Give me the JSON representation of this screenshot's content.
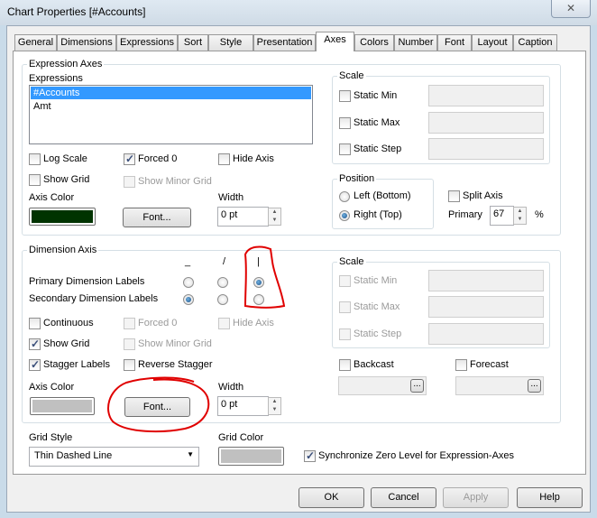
{
  "window": {
    "title": "Chart Properties [#Accounts]",
    "close_icon": "✕"
  },
  "tabs": [
    "General",
    "Dimensions",
    "Expressions",
    "Sort",
    "Style",
    "Presentation",
    "Axes",
    "Colors",
    "Number",
    "Font",
    "Layout",
    "Caption"
  ],
  "active_tab": "Axes",
  "expression_axes": {
    "group": "Expression Axes",
    "expressions_label": "Expressions",
    "expressions": [
      "#Accounts",
      "Amt"
    ],
    "selected": "#Accounts",
    "log_scale": "Log Scale",
    "forced0": "Forced 0",
    "hide_axis": "Hide Axis",
    "show_grid": "Show Grid",
    "show_minor_grid": "Show Minor Grid",
    "axis_color_label": "Axis Color",
    "axis_color": "#003300",
    "font_button": "Font...",
    "width_label": "Width",
    "width_value": "0 pt",
    "scale": {
      "label": "Scale",
      "static_min": "Static Min",
      "static_max": "Static Max",
      "static_step": "Static Step"
    },
    "position": {
      "label": "Position",
      "left": "Left (Bottom)",
      "right": "Right (Top)"
    },
    "split_axis": "Split Axis",
    "primary_label": "Primary",
    "primary_value": "67",
    "percent": "%"
  },
  "dimension_axis": {
    "group": "Dimension Axis",
    "orientation_headers": [
      "_",
      "/",
      "|"
    ],
    "primary_labels": "Primary Dimension Labels",
    "secondary_labels": "Secondary Dimension Labels",
    "continuous": "Continuous",
    "forced0": "Forced 0",
    "hide_axis": "Hide Axis",
    "show_grid": "Show Grid",
    "show_minor_grid": "Show Minor Grid",
    "stagger_labels": "Stagger Labels",
    "reverse_stagger": "Reverse Stagger",
    "axis_color_label": "Axis Color",
    "axis_color": "#c0c0c0",
    "font_button": "Font...",
    "width_label": "Width",
    "width_value": "0 pt",
    "scale": {
      "label": "Scale",
      "static_min": "Static Min",
      "static_max": "Static Max",
      "static_step": "Static Step"
    },
    "backcast": "Backcast",
    "forecast": "Forecast",
    "ellipsis": "..."
  },
  "grid_style": {
    "label": "Grid Style",
    "value": "Thin Dashed Line"
  },
  "grid_color": {
    "label": "Grid Color",
    "value": "#c0c0c0"
  },
  "sync_zero": "Synchronize Zero Level for Expression-Axes",
  "buttons": {
    "ok": "OK",
    "cancel": "Cancel",
    "apply": "Apply",
    "help": "Help"
  },
  "annotation_color": "#e00000"
}
